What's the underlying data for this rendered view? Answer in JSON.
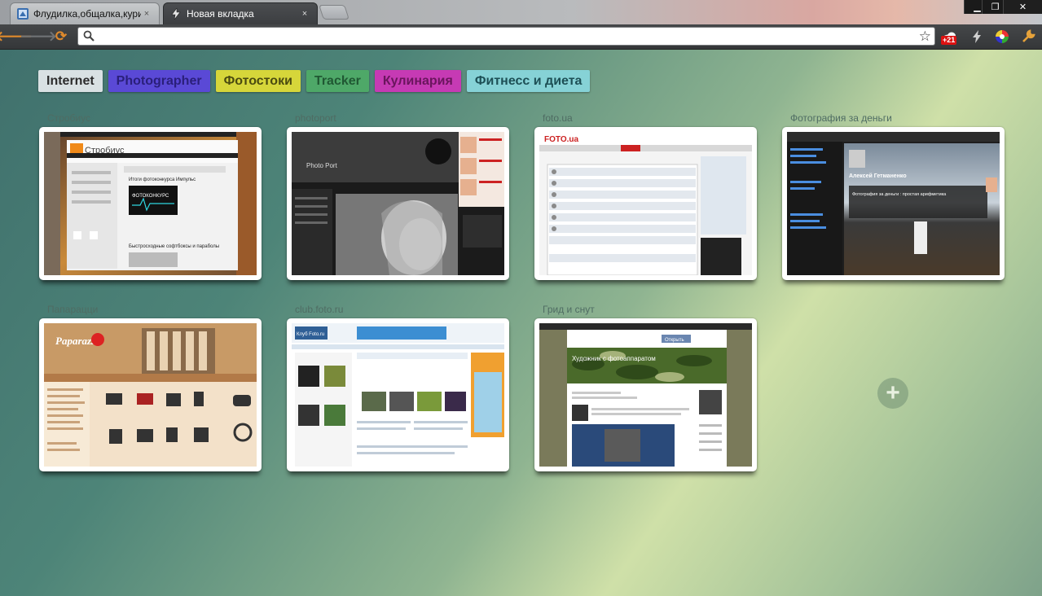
{
  "browser": {
    "tabs": [
      {
        "title": "Флудилка,общалка,курил",
        "active": false
      },
      {
        "title": "Новая вкладка",
        "active": true
      }
    ],
    "window_controls": {
      "minimize": "▁",
      "maximize": "❐",
      "close": "✕"
    },
    "tab_close_glyph": "×",
    "toolbar": {
      "back": "🡐",
      "forward": "🡒",
      "reload": "⟳",
      "address_value": "",
      "address_placeholder": "",
      "bookmark_star": "☆",
      "weather_badge": "+21"
    }
  },
  "speed_dial": {
    "groups": [
      {
        "label": "Internet",
        "color": "#d9e1e3"
      },
      {
        "label": "Photographer",
        "color": "#5a49d6"
      },
      {
        "label": "Фотостоки",
        "color": "#d6d63a"
      },
      {
        "label": "Tracker",
        "color": "#4ea868"
      },
      {
        "label": "Кулинария",
        "color": "#c63ab4"
      },
      {
        "label": "Фитнесс и диета",
        "color": "#86d2d6"
      }
    ],
    "dials": [
      {
        "title": "Стробиус",
        "thumb_lines": [
          "Стробиус",
          "Итоги фотоконкурса Импульс",
          "ФОТОКОНКУРС",
          "Быстросходные софтбоксы и параболы"
        ]
      },
      {
        "title": "photoport",
        "thumb_lines": [
          "Photo Port"
        ]
      },
      {
        "title": "foto.ua",
        "thumb_lines": [
          "FOTO.ua"
        ]
      },
      {
        "title": "Фотография за деньги",
        "thumb_lines": [
          "Алексей Гетманенко",
          "Фотография за деньги : простая арифметика"
        ]
      },
      {
        "title": "Папарацци",
        "thumb_lines": [
          "Paparazzi"
        ]
      },
      {
        "title": "club.foto.ru",
        "thumb_lines": [
          "Клуб Foto.ru"
        ]
      },
      {
        "title": "Грид и снут",
        "thumb_lines": [
          "Художник с фотоаппаратом",
          "Открыть"
        ]
      }
    ],
    "add_button": "+"
  }
}
